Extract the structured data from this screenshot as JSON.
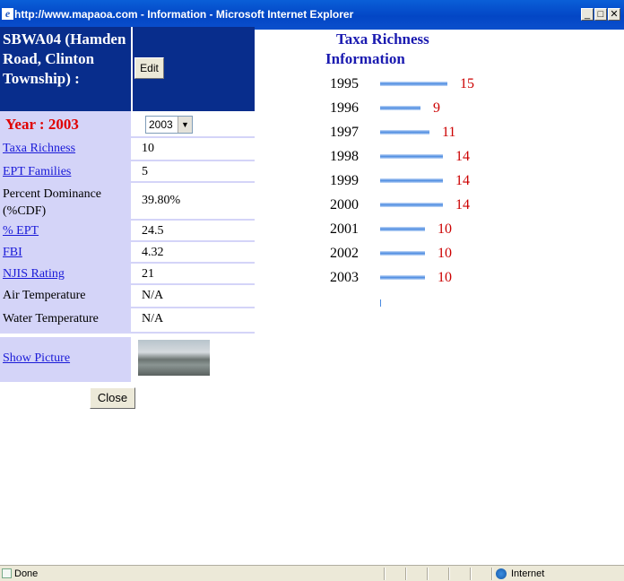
{
  "window": {
    "title": "http://www.mapaoa.com - Information - Microsoft Internet Explorer",
    "minimize": "_",
    "maximize": "□",
    "close": "✕"
  },
  "station": {
    "title": "SBWA04 (Hamden Road, Clinton Township) :",
    "edit_label": "Edit"
  },
  "year": {
    "label": "Year : 2003",
    "selected": "2003"
  },
  "metrics": [
    {
      "label": "Taxa Richness ",
      "value": "10",
      "is_link": true
    },
    {
      "label": "EPT Families",
      "value": "5",
      "is_link": true
    },
    {
      "label": "Percent Dominance (%CDF)",
      "value": "39.80%",
      "is_link": false
    },
    {
      "label": "% EPT ",
      "value": "24.5",
      "is_link": true
    },
    {
      "label": "FBI",
      "value": "4.32",
      "is_link": true
    },
    {
      "label": "NJIS Rating",
      "value": "21",
      "is_link": true
    },
    {
      "label": "Air Temperature",
      "value": "N/A",
      "is_link": false
    },
    {
      "label": "Water Temperature",
      "value": "N/A",
      "is_link": false
    }
  ],
  "picture": {
    "label": "Show Picture"
  },
  "close_label": "Close",
  "chart_data": {
    "type": "bar",
    "title": "Taxa Richness Information",
    "categories": [
      "1995",
      "1996",
      "1997",
      "1998",
      "1999",
      "2000",
      "2001",
      "2002",
      "2003"
    ],
    "values": [
      15,
      9,
      11,
      14,
      14,
      14,
      10,
      10,
      10
    ],
    "value_color": "#cc0000",
    "bar_color": "#4a8ae0"
  },
  "status": {
    "text": "Done",
    "zone": "Internet"
  }
}
